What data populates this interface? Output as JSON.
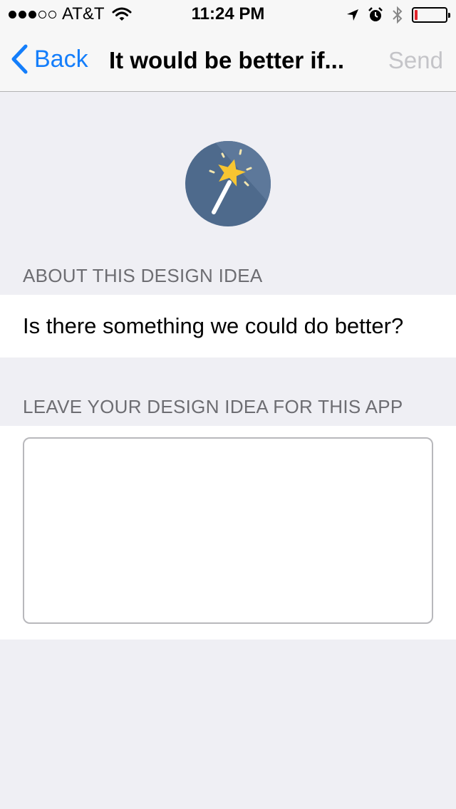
{
  "status_bar": {
    "carrier": "AT&T",
    "time": "11:24 PM",
    "signal_bars_filled": 3,
    "signal_bars_total": 5,
    "battery_level_percent": 10
  },
  "nav": {
    "back_label": "Back",
    "title": "It would be better if...",
    "send_label": "Send"
  },
  "about": {
    "header": "ABOUT THIS DESIGN IDEA",
    "question": "Is there something we could do better?"
  },
  "idea": {
    "header": "LEAVE YOUR DESIGN IDEA FOR THIS APP",
    "value": ""
  },
  "colors": {
    "accent": "#147efb",
    "background": "#efeff4",
    "icon_bg": "#4e6a8c",
    "star": "#f7c531",
    "battery_low": "#e0262d",
    "send_disabled": "#c4c4c8"
  },
  "icons": [
    "signal-icon",
    "wifi-icon",
    "location-arrow-icon",
    "alarm-icon",
    "bluetooth-icon",
    "battery-icon",
    "chevron-left-icon",
    "magic-wand-icon"
  ]
}
